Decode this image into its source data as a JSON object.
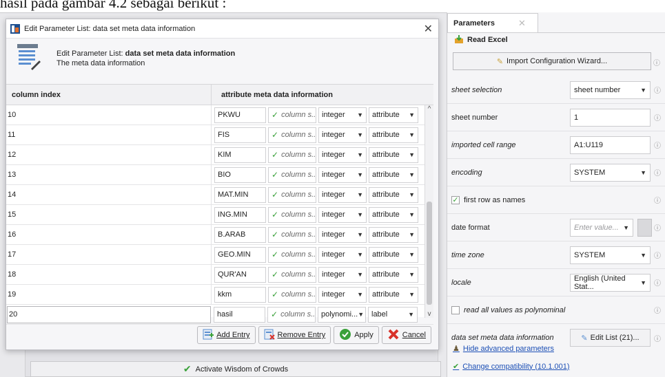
{
  "doc_caption": "hasil pada gambar 4.2 sebagai berikut :",
  "dialog": {
    "title": "Edit Parameter List: data set meta data information",
    "header_prefix": "Edit Parameter List: ",
    "header_bold": "data set meta data information",
    "header_desc": "The meta data information",
    "columns": [
      "column index",
      "attribute meta data information"
    ],
    "rows": [
      {
        "index": "10",
        "name": "PKWU",
        "check_label": "column s...",
        "type": "integer",
        "role": "attribute"
      },
      {
        "index": "11",
        "name": "FIS",
        "check_label": "column s...",
        "type": "integer",
        "role": "attribute"
      },
      {
        "index": "12",
        "name": "KIM",
        "check_label": "column s...",
        "type": "integer",
        "role": "attribute"
      },
      {
        "index": "13",
        "name": "BIO",
        "check_label": "column s...",
        "type": "integer",
        "role": "attribute"
      },
      {
        "index": "14",
        "name": "MAT.MIN",
        "check_label": "column s...",
        "type": "integer",
        "role": "attribute"
      },
      {
        "index": "15",
        "name": "ING.MIN",
        "check_label": "column s...",
        "type": "integer",
        "role": "attribute"
      },
      {
        "index": "16",
        "name": "B.ARAB",
        "check_label": "column s...",
        "type": "integer",
        "role": "attribute"
      },
      {
        "index": "17",
        "name": "GEO.MIN",
        "check_label": "column s...",
        "type": "integer",
        "role": "attribute"
      },
      {
        "index": "18",
        "name": "QUR'AN",
        "check_label": "column s...",
        "type": "integer",
        "role": "attribute"
      },
      {
        "index": "19",
        "name": "kkm",
        "check_label": "column s...",
        "type": "integer",
        "role": "attribute"
      },
      {
        "index": "20",
        "name": "hasil",
        "check_label": "column s...",
        "type": "polynomi...",
        "role": "label"
      }
    ],
    "buttons": {
      "add_entry": "Add Entry",
      "remove_entry": "Remove Entry",
      "apply": "Apply",
      "cancel": "Cancel"
    }
  },
  "background": {
    "wisdom_button": "Activate Wisdom of Crowds"
  },
  "params": {
    "tab_label": "Parameters",
    "operator": "Read Excel",
    "wizard_button": "Import Configuration Wizard...",
    "sheet_selection_label": "sheet selection",
    "sheet_selection_value": "sheet number",
    "sheet_number_label": "sheet number",
    "sheet_number_value": "1",
    "cell_range_label": "imported cell range",
    "cell_range_value": "A1:U119",
    "encoding_label": "encoding",
    "encoding_value": "SYSTEM",
    "first_row_label": "first row as names",
    "date_format_label": "date format",
    "date_format_placeholder": "Enter value...",
    "time_zone_label": "time zone",
    "time_zone_value": "SYSTEM",
    "locale_label": "locale",
    "locale_value": "English (United Stat...",
    "read_all_label": "read all values as polynominal",
    "meta_label": "data set meta data information",
    "edit_list_button": "Edit List (21)...",
    "hide_advanced": "Hide advanced parameters",
    "change_compat": "Change compatibility (10.1.001)"
  },
  "colors": {
    "accent_link": "#1c4fb5",
    "check_green": "#3aa13a",
    "cancel_red": "#d8322a"
  }
}
